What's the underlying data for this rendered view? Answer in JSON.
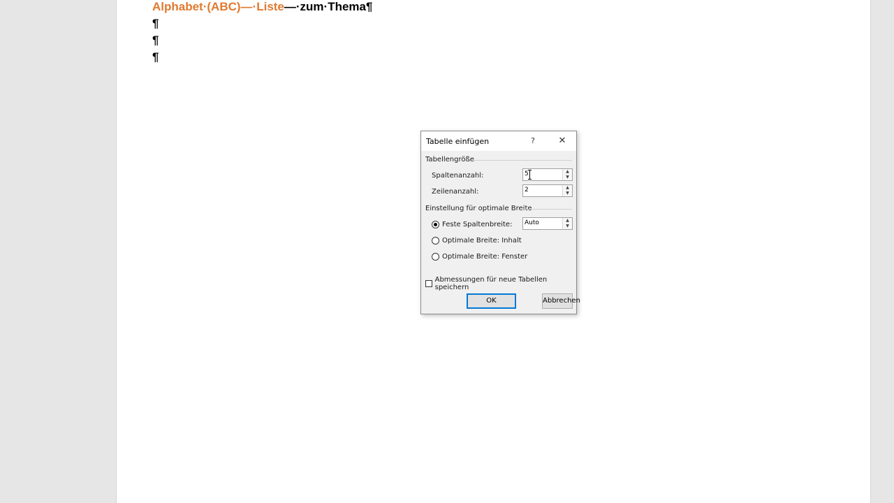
{
  "document": {
    "heading_part1": "Alphabet·(ABC)",
    "heading_part2": "—·Liste",
    "heading_part3": "—·zum·Thema¶",
    "pilcrows": [
      "¶",
      "¶",
      "¶"
    ]
  },
  "dialog": {
    "title": "Tabelle einfügen",
    "help_label": "?",
    "close_label": "✕",
    "size_group": "Tabellengröße",
    "columns_label": "Spaltenanzahl:",
    "columns_value": "5",
    "rows_label": "Zeilenanzahl:",
    "rows_value": "2",
    "autofit_group": "Einstellung für optimale Breite",
    "fixed_width_label": "Feste Spaltenbreite:",
    "fixed_width_value": "Auto",
    "autofit_content_label": "Optimale Breite: Inhalt",
    "autofit_window_label": "Optimale Breite: Fenster",
    "remember_label": "Abmessungen für neue Tabellen speichern",
    "ok_label": "OK",
    "cancel_label": "Abbrechen",
    "spin_up": "▲",
    "spin_down": "▼"
  },
  "colors": {
    "heading_accent": "#e07a2f",
    "focus_blue": "#0078d7"
  }
}
